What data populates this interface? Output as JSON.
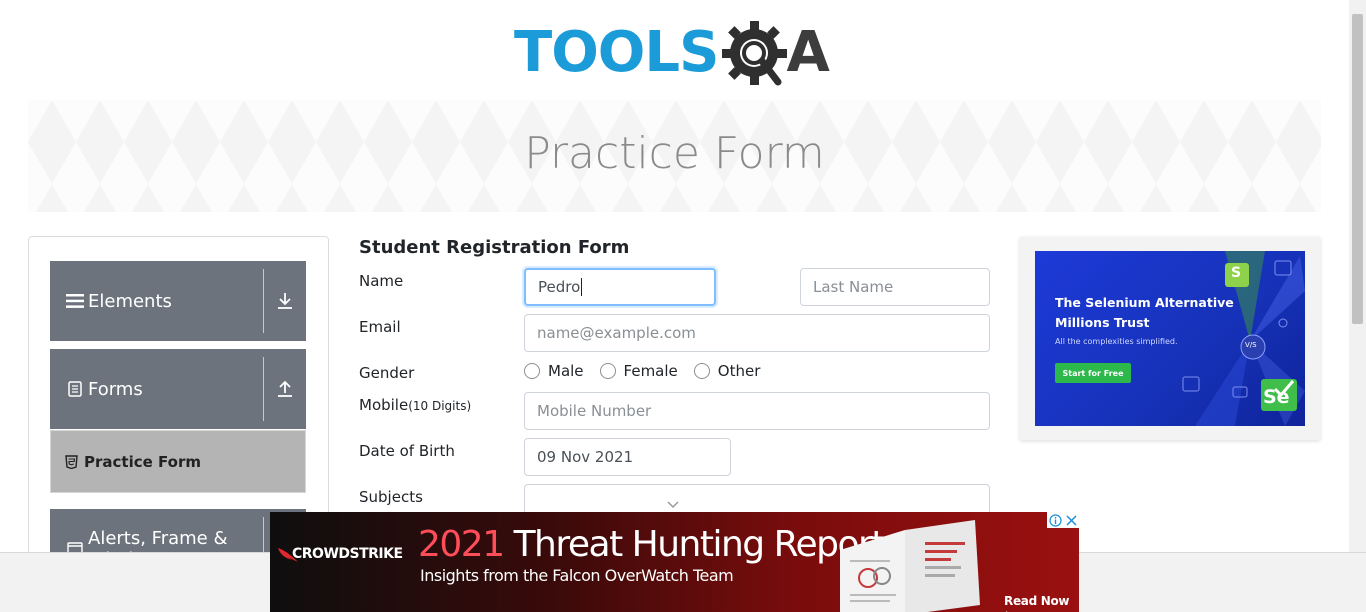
{
  "logo": {
    "text": "TOOLS",
    "text_qa_a": "A",
    "color_primary": "#1b9bd7",
    "color_dark": "#3d3d3d"
  },
  "banner": {
    "title": "Practice Form"
  },
  "sidebar": {
    "groups": [
      {
        "label": "Elements",
        "icon": "hamburger-icon",
        "arrow": "download-arrow-icon"
      },
      {
        "label": "Forms",
        "icon": "document-icon",
        "arrow": "upload-arrow-icon"
      },
      {
        "label": "Alerts, Frame & Windows",
        "icon": "window-icon",
        "arrow": "download-arrow-icon"
      }
    ],
    "active_item": {
      "label": "Practice Form",
      "icon": "html5-icon"
    }
  },
  "form": {
    "title": "Student Registration Form",
    "name_label": "Name",
    "first_name_value": "Pedro",
    "last_name_placeholder": "Last Name",
    "email_label": "Email",
    "email_placeholder": "name@example.com",
    "gender_label": "Gender",
    "gender_options": [
      "Male",
      "Female",
      "Other"
    ],
    "mobile_label": "Mobile",
    "mobile_hint": "(10 Digits)",
    "mobile_placeholder": "Mobile Number",
    "dob_label": "Date of Birth",
    "dob_value": "09 Nov 2021",
    "subjects_label": "Subjects"
  },
  "right_ad": {
    "headline_line1": "The Selenium Alternative",
    "headline_line2": "Millions Trust",
    "subline": "All the complexities simplified.",
    "cta": "Start for Free",
    "logo_letters": "Se",
    "badge_letter": "S",
    "vs_text": "V/S"
  },
  "bottom_ad": {
    "brand": "CROWDSTRIKE",
    "year": "2021",
    "title_rest": " Threat Hunting Report",
    "subtitle": "Insights from the Falcon OverWatch Team",
    "read_now": "Read Now ↘"
  }
}
